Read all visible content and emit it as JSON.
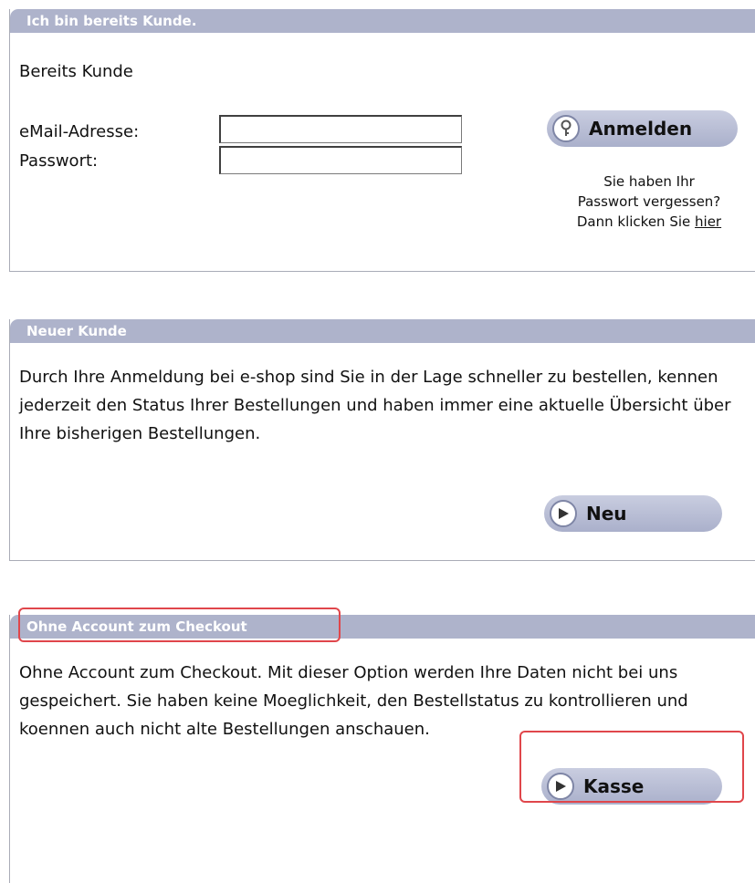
{
  "existing": {
    "header": "Ich bin bereits Kunde.",
    "subtitle": "Bereits Kunde",
    "email_label": "eMail-Adresse:",
    "email_value": "",
    "password_label": "Passwort:",
    "password_value": "",
    "login_button": "Anmelden",
    "forgot_line1": "Sie haben Ihr",
    "forgot_line2": "Passwort vergessen?",
    "forgot_line3": "Dann klicken Sie",
    "forgot_link": "hier"
  },
  "new_customer": {
    "header": "Neuer Kunde",
    "text": "Durch Ihre Anmeldung bei e-shop sind Sie in der Lage schneller zu bestellen, kennen jederzeit den Status Ihrer Bestellungen und haben immer eine aktuelle Übersicht über Ihre bisherigen Bestellungen.",
    "button": "Neu"
  },
  "guest": {
    "header": "Ohne Account zum Checkout",
    "text": "Ohne Account zum Checkout. Mit dieser Option werden Ihre Daten nicht bei uns gespeichert. Sie haben keine Moeglichkeit, den Bestellstatus zu kontrollieren und koennen auch nicht alte Bestellungen anschauen.",
    "button": "Kasse"
  },
  "colors": {
    "header_bg": "#aeb3cb",
    "button_bg": "#b9bed6",
    "highlight": "#e0464b"
  },
  "icons": {
    "login": "key-icon",
    "new": "arrow-right-icon",
    "checkout": "arrow-right-icon"
  }
}
